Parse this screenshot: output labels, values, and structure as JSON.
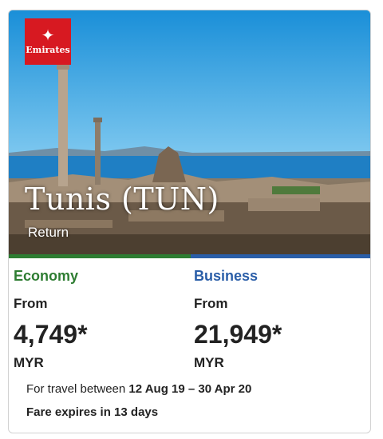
{
  "brand": {
    "logo_text": "Emirates",
    "logo_mark": "✦",
    "color": "#d71921"
  },
  "destination": {
    "title": "Tunis (TUN)",
    "trip_type": "Return"
  },
  "fares": {
    "economy": {
      "label": "Economy",
      "from": "From",
      "price": "4,749*",
      "currency": "MYR",
      "color": "#2e7d32"
    },
    "business": {
      "label": "Business",
      "from": "From",
      "price": "21,949*",
      "currency": "MYR",
      "color": "#2a5ea8"
    }
  },
  "travel": {
    "prefix": "For travel between",
    "dates": "12 Aug 19 – 30 Apr 20"
  },
  "expiry": "Fare expires in 13 days"
}
